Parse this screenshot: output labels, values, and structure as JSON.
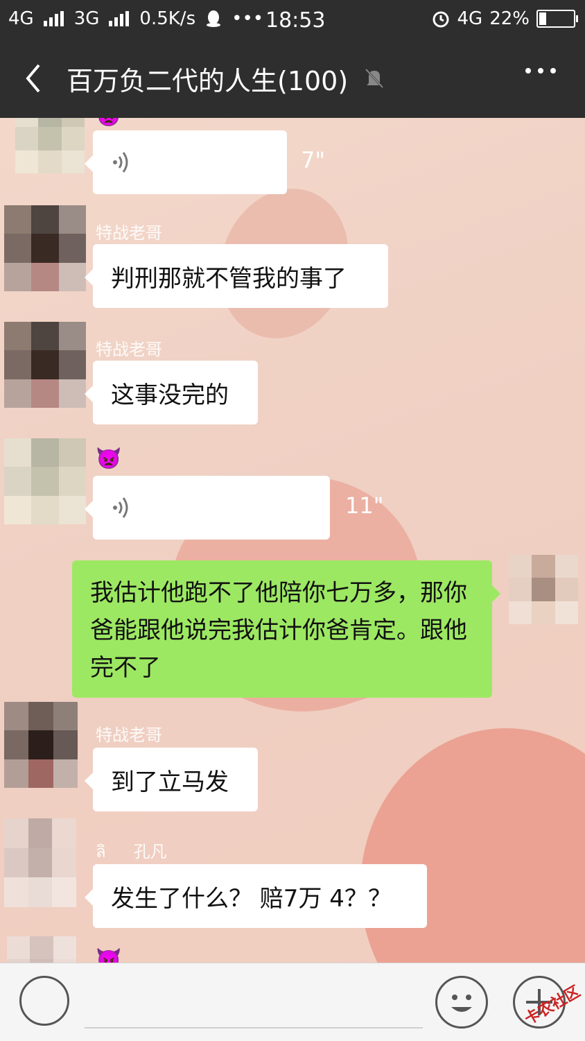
{
  "status_bar": {
    "network1": "4G",
    "network2": "3G",
    "speed": "0.5K/s",
    "dots": "•••",
    "time": "18:53",
    "network3": "4G",
    "battery": "22%"
  },
  "header": {
    "title": "百万负二代的人生(100)"
  },
  "messages": [
    {
      "type": "voice",
      "duration": "7\""
    },
    {
      "sender": "特战老哥",
      "text": "判刑那就不管我的事了"
    },
    {
      "sender": "特战老哥",
      "text": "这事没完的"
    },
    {
      "sender_emoji": "👿",
      "type": "voice",
      "duration": "11\""
    },
    {
      "text": "我估计他跑不了他陪你七万多，那你爸能跟他说完我估计你爸肯定。跟他完不了",
      "mine": true
    },
    {
      "sender": "特战老哥",
      "text": "到了立马发"
    },
    {
      "sender_prefix": "ลิ",
      "sender": "孔凡",
      "text": "发生了什么？ 赔7万 4？？"
    }
  ],
  "watermark": "卡农社区"
}
